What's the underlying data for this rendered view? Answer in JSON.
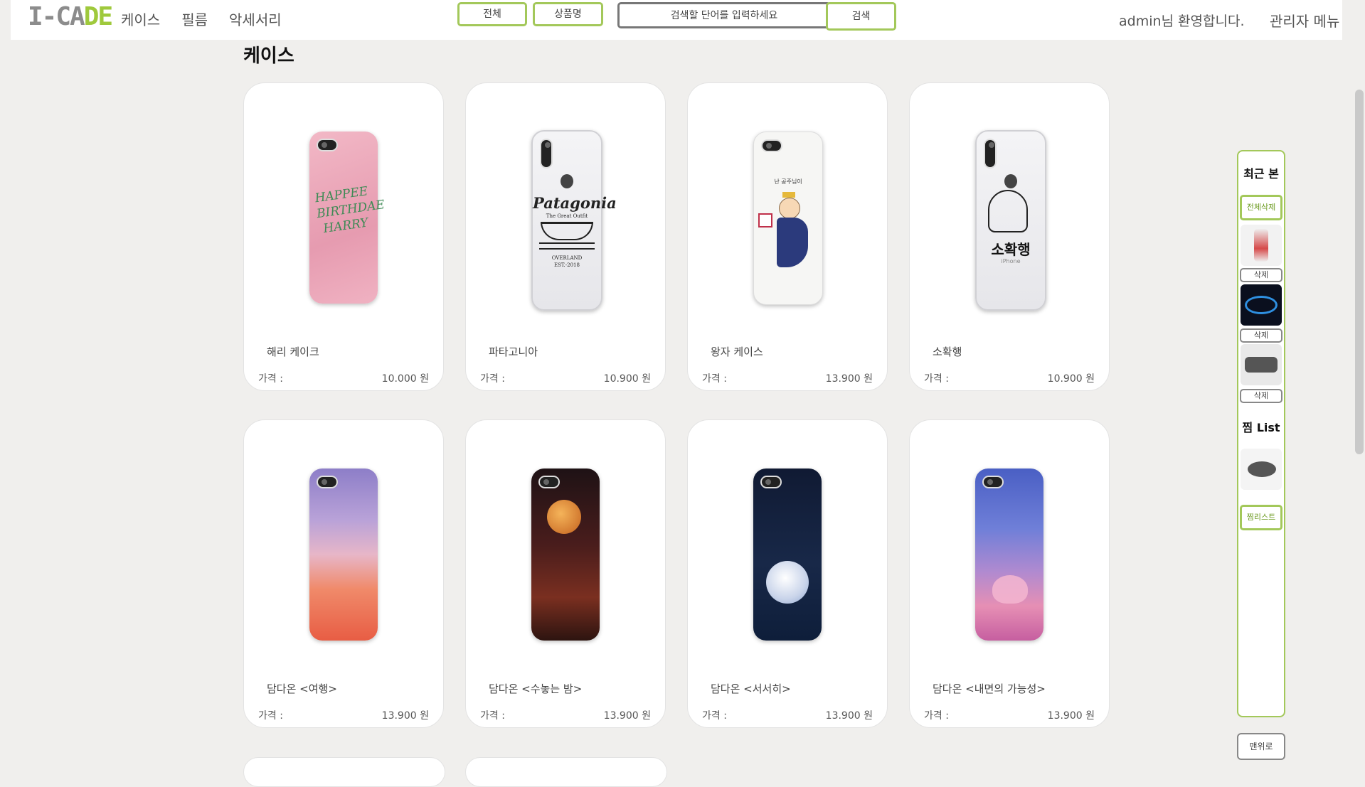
{
  "header": {
    "logo": {
      "part1": "I-CA",
      "part2": "DE"
    },
    "nav": [
      "케이스",
      "필름",
      "악세서리"
    ],
    "filter_all": "전체",
    "filter_name": "상품명",
    "search_placeholder": "검색할 단어를 입력하세요",
    "search_button": "검색",
    "welcome": "admin님 환영합니다.",
    "admin_menu": "관리자 메뉴"
  },
  "page_title": "케이스",
  "products": [
    {
      "name": "해리 케이크",
      "price_label": "가격 :",
      "price": "10.000 원"
    },
    {
      "name": "파타고니아",
      "price_label": "가격 :",
      "price": "10.900 원"
    },
    {
      "name": "왕자 케이스",
      "price_label": "가격 :",
      "price": "13.900 원"
    },
    {
      "name": "소확행",
      "price_label": "가격 :",
      "price": "10.900 원"
    },
    {
      "name": "담다온 <여행>",
      "price_label": "가격 :",
      "price": "13.900 원"
    },
    {
      "name": "담다온 <수놓는 밤>",
      "price_label": "가격 :",
      "price": "13.900 원"
    },
    {
      "name": "담다온 <서서히>",
      "price_label": "가격 :",
      "price": "13.900 원"
    },
    {
      "name": "담다온 <내면의 가능성>",
      "price_label": "가격 :",
      "price": "13.900 원"
    }
  ],
  "case_art": {
    "harry": "HAPPEE BIRTHDAE HARRY",
    "patagonia_brand": "Patagonia",
    "patagonia_sub": "The Great Outfit",
    "patagonia_line1": "OVERLAND",
    "patagonia_line2": "EST.-2018",
    "prince_text": "난 공주님이",
    "sohwak": "소확행",
    "sohwak_sub": "iPhone"
  },
  "sidebar": {
    "recent_title": "최근 본",
    "delete_all": "전체삭제",
    "delete": "삭제",
    "wish_title": "찜 List",
    "wishlist_button": "찜리스트"
  },
  "top_button": "맨위로",
  "colors": {
    "accent": "#a3c85a",
    "logo_gray": "#8c8c8c",
    "logo_green": "#9fc93c"
  }
}
